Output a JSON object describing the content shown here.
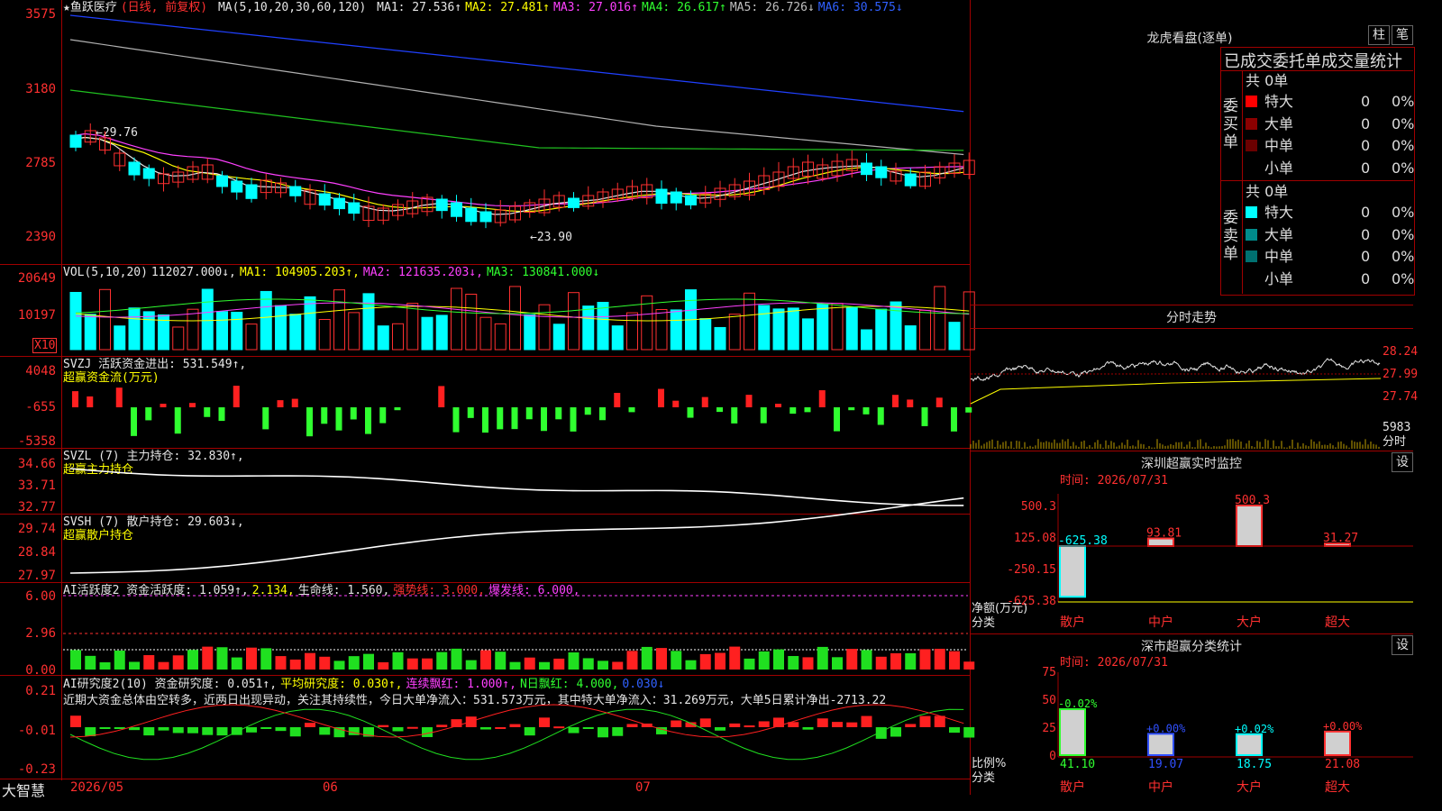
{
  "main": {
    "title": "★鱼跃医疗",
    "mode": "(日线, 前复权)",
    "ma_label": "MA(5,10,20,30,60,120)",
    "ma": [
      {
        "label": "MA1: 27.536↑",
        "color": "#e6e6e6"
      },
      {
        "label": "MA2: 27.481↑",
        "color": "#ffff00"
      },
      {
        "label": "MA3: 27.016↑",
        "color": "#ff40ff"
      },
      {
        "label": "MA4: 26.617↑",
        "color": "#30ff30"
      },
      {
        "label": "MA5: 26.726↓",
        "color": "#c0c0c0"
      },
      {
        "label": "MA6: 30.575↓",
        "color": "#3060ff"
      }
    ],
    "yaxis": [
      "3575",
      "3180",
      "2785",
      "2390"
    ],
    "annot_high": "←29.76",
    "annot_low": "←23.90"
  },
  "vol": {
    "label": "VOL(5,10,20)",
    "value": "112027.000↓,",
    "ma1": "MA1: 104905.203↑,",
    "ma2": "MA2: 121635.203↓,",
    "ma3": "MA3: 130841.000↓",
    "yaxis": [
      "20649",
      "10197"
    ],
    "unit": "X10"
  },
  "svzj": {
    "label": "SVZJ  活跃资金进出: 531.549↑,",
    "sub": "超赢资金流(万元)",
    "yaxis": [
      "4048",
      "-655",
      "-5358"
    ]
  },
  "svzl": {
    "label": "SVZL (7) 主力持仓: 32.830↑,",
    "sub": "超赢主力持仓",
    "yaxis": [
      "34.66",
      "33.71",
      "32.77"
    ]
  },
  "svsh": {
    "label": "SVSH (7) 散户持仓: 29.603↓,",
    "sub": "超赢散户持仓",
    "yaxis": [
      "29.74",
      "28.84",
      "27.97"
    ]
  },
  "ai1": {
    "label": "AI活跃度2 资金活跃度: 1.059↑,",
    "v2": "2.134,",
    "life": "生命线: 1.560,",
    "strong": "强势线: 3.000,",
    "burst": "爆发线: 6.000,",
    "yaxis": [
      "6.00",
      "2.96",
      "0.00"
    ]
  },
  "ai2": {
    "label": "AI研究度2(10) 资金研究度: 0.051↑,",
    "avg": "平均研究度: 0.030↑,",
    "cont": "连续飘红: 1.000↑,",
    "nday": "N日飘红: 4.000,",
    "extra": "0.030↓",
    "text": "近期大资金总体由空转多，近两日出现异动，关注其持续性，今日大单净流入：531.573万元，其中特大单净流入：31.269万元，大单5日累计净出-2713.22",
    "yaxis": [
      "0.21",
      "-0.01",
      "-0.23"
    ]
  },
  "xaxis": {
    "brand": "大智慧",
    "dates": [
      "2026/05",
      "06",
      "07"
    ]
  },
  "right": {
    "lhb_title": "龙虎看盘(逐单)",
    "btn_bar": "柱",
    "btn_pen": "笔",
    "stats_title": "已成交委托单成交量统计",
    "buy_side": "委买单",
    "sell_side": "委卖单",
    "buy_total": "共 0单",
    "sell_total": "共 0单",
    "buy_rows": [
      {
        "name": "特大",
        "val": "0",
        "pct": "0%",
        "color": "#ff0000"
      },
      {
        "name": "大单",
        "val": "0",
        "pct": "0%",
        "color": "#8b0000"
      },
      {
        "name": "中单",
        "val": "0",
        "pct": "0%",
        "color": "#6b0000"
      },
      {
        "name": "小单",
        "val": "0",
        "pct": "0%",
        "color": "#000000"
      }
    ],
    "sell_rows": [
      {
        "name": "特大",
        "val": "0",
        "pct": "0%",
        "color": "#00ffff"
      },
      {
        "name": "大单",
        "val": "0",
        "pct": "0%",
        "color": "#008b8b"
      },
      {
        "name": "中单",
        "val": "0",
        "pct": "0%",
        "color": "#007070"
      },
      {
        "name": "小单",
        "val": "0",
        "pct": "0%",
        "color": "#000000"
      }
    ],
    "intraday_title": "分时走势",
    "intraday_yaxis": [
      "28.24",
      "27.99",
      "27.74"
    ],
    "intraday_vol": "5983",
    "intraday_unit": "分时",
    "sz_title": "深圳超赢实时监控",
    "sz_btn": "设",
    "sz_time": "时间: 2026/07/31",
    "sz_yaxis": [
      "500.3",
      "125.08",
      "-250.15",
      "-625.38"
    ],
    "sz_unit1": "净额(万元)",
    "sz_unit2": "分类",
    "sz_bars": [
      {
        "label": "散户",
        "value": -625.38,
        "text": "-625.38"
      },
      {
        "label": "中户",
        "value": 93.81,
        "text": "93.81"
      },
      {
        "label": "大户",
        "value": 500.3,
        "text": "500.3"
      },
      {
        "label": "超大",
        "value": 31.27,
        "text": "31.27"
      }
    ],
    "stat_title": "深市超赢分类统计",
    "stat_btn": "设",
    "stat_time": "时间: 2026/07/31",
    "stat_yaxis": [
      "75",
      "50",
      "25",
      "0"
    ],
    "stat_unit1": "比例%",
    "stat_unit2": "分类",
    "stat_bars": [
      {
        "label": "散户",
        "value": 41.1,
        "text": "41.10",
        "chg": "-0.02%",
        "color": "#30ff30"
      },
      {
        "label": "中户",
        "value": 19.07,
        "text": "19.07",
        "chg": "+0.00%",
        "color": "#3050ff"
      },
      {
        "label": "大户",
        "value": 18.75,
        "text": "18.75",
        "chg": "+0.02%",
        "color": "#00ffff"
      },
      {
        "label": "超大",
        "value": 21.08,
        "text": "21.08",
        "chg": "+0.00%",
        "color": "#ff3030"
      }
    ]
  }
}
